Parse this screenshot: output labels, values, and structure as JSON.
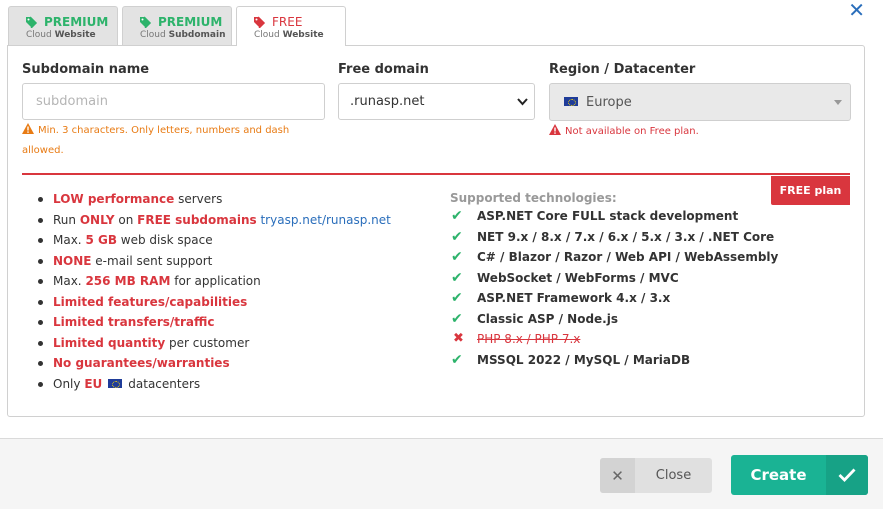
{
  "tabs": [
    {
      "title": "PREMIUM",
      "sub_prefix": "Cloud",
      "sub_bold": "Website",
      "state": "inactive"
    },
    {
      "title": "PREMIUM",
      "sub_prefix": "Cloud",
      "sub_bold": "Subdomain",
      "state": "inactive"
    },
    {
      "title": "FREE",
      "sub_prefix": "Cloud",
      "sub_bold": "Website",
      "state": "active"
    }
  ],
  "colors": {
    "accent_green": "#2db36b",
    "accent_red": "#d9363e",
    "primary_teal": "#1ab394",
    "link_blue": "#2a6ebb",
    "warn_orange": "#e87b14"
  },
  "form": {
    "subdomain_label": "Subdomain name",
    "subdomain_placeholder": "subdomain",
    "subdomain_value": "",
    "subdomain_hint": "Min. 3 characters. Only letters, numbers and dash allowed.",
    "domain_label": "Free domain",
    "domain_value": ".runasp.net",
    "region_label": "Region / Datacenter",
    "region_value": "Europe",
    "region_hint": "Not available on Free plan."
  },
  "plan_badge": "FREE plan",
  "features": {
    "f1": {
      "a": "LOW performance",
      "b": " servers"
    },
    "f2": {
      "a": "Run ",
      "b": "ONLY",
      "c": " on ",
      "d": "FREE subdomains",
      "e": " tryasp.net/runasp.net"
    },
    "f3": {
      "a": "Max. ",
      "b": "5 GB",
      "c": " web disk space"
    },
    "f4": {
      "a": "NONE",
      "b": " e-mail sent support"
    },
    "f5": {
      "a": "Max. ",
      "b": "256 MB RAM",
      "c": " for application"
    },
    "f6": "Limited features/capabilities",
    "f7": "Limited transfers/traffic",
    "f8": {
      "a": "Limited quantity",
      "b": " per customer"
    },
    "f9": "No guarantees/warranties",
    "f10": {
      "a": "Only ",
      "b": "EU",
      "c": "datacenters"
    }
  },
  "tech": {
    "title": "Supported technologies:",
    "items": [
      {
        "label": "ASP.NET Core FULL stack development",
        "icon": "check-icon"
      },
      {
        "label": "NET 9.x / 8.x / 7.x / 6.x / 5.x / 3.x / .NET Core",
        "icon": "check-icon"
      },
      {
        "label": "C# / Blazor / Razor / Web API / WebAssembly",
        "icon": "check-icon"
      },
      {
        "label": "WebSocket / WebForms / MVC",
        "icon": "check-icon"
      },
      {
        "label": "ASP.NET Framework 4.x / 3.x",
        "icon": "check-icon"
      },
      {
        "label": "Classic ASP / Node.js",
        "icon": "check-icon"
      },
      {
        "label": "PHP 8.x / PHP 7.x",
        "icon": "cross-icon"
      },
      {
        "label": "MSSQL 2022 / MySQL / MariaDB",
        "icon": "check-icon"
      }
    ]
  },
  "footer": {
    "close_label": "Close",
    "create_label": "Create"
  }
}
